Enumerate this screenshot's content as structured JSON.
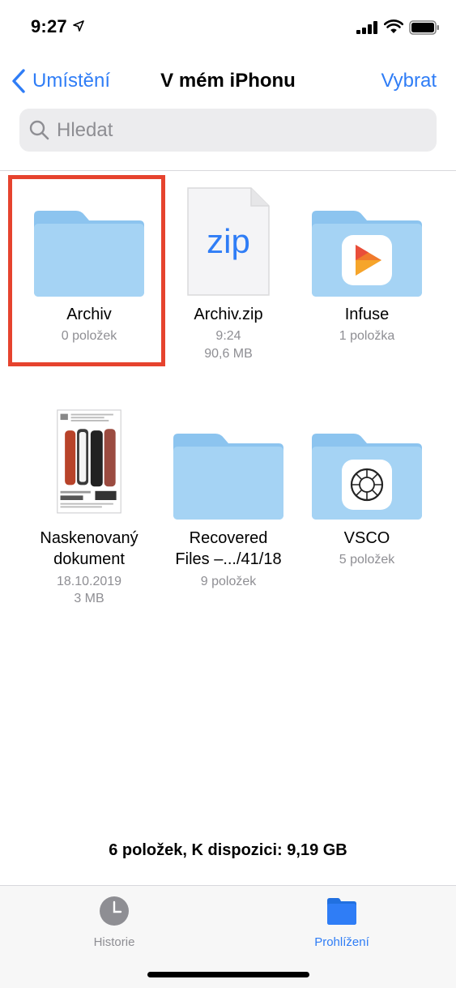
{
  "status_bar": {
    "time": "9:27"
  },
  "nav": {
    "back_label": "Umístění",
    "title": "V mém iPhonu",
    "select_label": "Vybrat"
  },
  "search": {
    "placeholder": "Hledat"
  },
  "items": [
    {
      "name": "Archiv",
      "meta1": "0 položek",
      "meta2": "",
      "icon": "folder-icon"
    },
    {
      "name": "Archiv.zip",
      "meta1": "9:24",
      "meta2": "90,6 MB",
      "icon": "zip-file-icon",
      "thumb_text": "zip"
    },
    {
      "name": "Infuse",
      "meta1": "1 položka",
      "meta2": "",
      "icon": "infuse-folder-icon"
    },
    {
      "name": "Naskenovaný",
      "name2": "dokument",
      "meta1": "18.10.2019",
      "meta2": "3 MB",
      "icon": "scanned-document-icon"
    },
    {
      "name": "Recovered",
      "name2": "Files –.../41/18",
      "meta1": "9 položek",
      "meta2": "",
      "icon": "folder-icon"
    },
    {
      "name": "VSCO",
      "meta1": "5 položek",
      "meta2": "",
      "icon": "vsco-folder-icon"
    }
  ],
  "footer": {
    "summary": "6 položek, K dispozici: 9,19 GB"
  },
  "tabs": [
    {
      "label": "Historie",
      "icon": "clock-icon",
      "active": false
    },
    {
      "label": "Prohlížení",
      "icon": "folder-icon",
      "active": true
    }
  ],
  "colors": {
    "accent": "#2f7df6",
    "folder": "#a5d3f4",
    "folder_dark": "#8cc4ef",
    "highlight": "#e6432e"
  }
}
